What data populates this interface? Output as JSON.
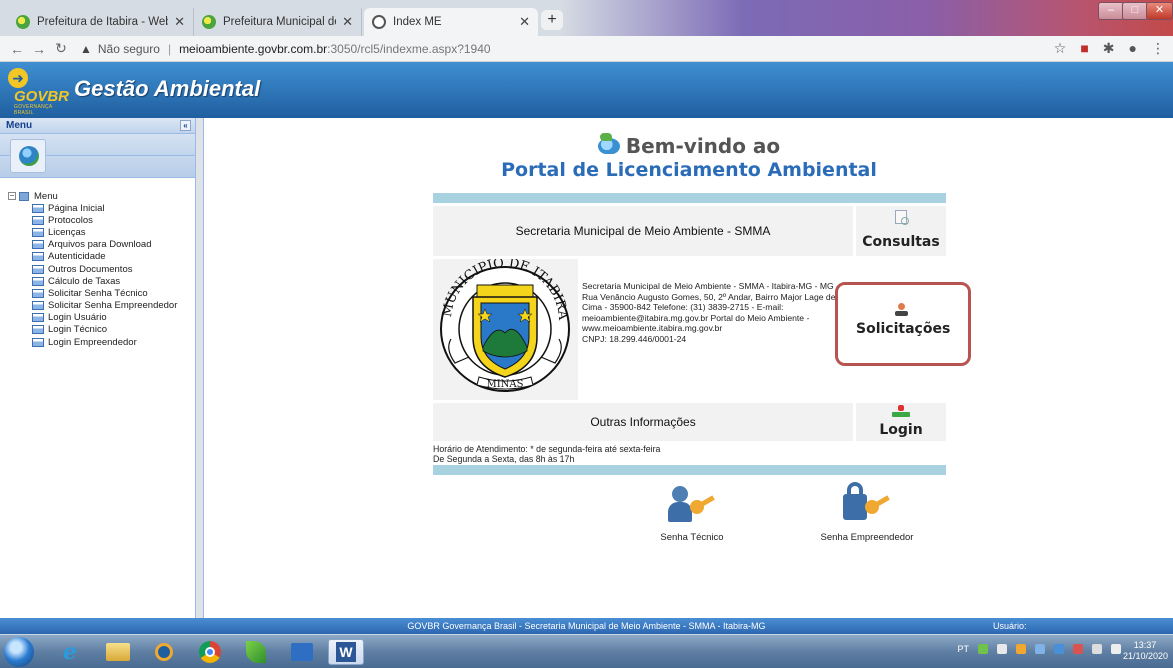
{
  "browser": {
    "tabs": [
      {
        "title": "Prefeitura de Itabira - Webmail :",
        "active": false
      },
      {
        "title": "Prefeitura Municipal de Itabira - I",
        "active": false
      },
      {
        "title": "Index ME",
        "active": true
      }
    ],
    "new_tab": "+",
    "security_label": "Não seguro",
    "url_host": "meioambiente.govbr.com.br",
    "url_path": ":3050/rcl5/indexme.aspx?1940"
  },
  "header": {
    "logo_text": "GOVBR",
    "logo_sub": "GOVERNANÇA BRASIL",
    "title": "Gestão Ambiental"
  },
  "sidebar": {
    "panel_title": "Menu",
    "root": "Menu",
    "items": [
      {
        "label": "Página Inicial"
      },
      {
        "label": "Protocolos"
      },
      {
        "label": "Licenças"
      },
      {
        "label": "Arquivos para Download"
      },
      {
        "label": "Autenticidade"
      },
      {
        "label": "Outros Documentos"
      },
      {
        "label": "Cálculo de Taxas"
      },
      {
        "label": "Solicitar Senha Técnico"
      },
      {
        "label": "Solicitar Senha Empreendedor"
      },
      {
        "label": "Login Usuário"
      },
      {
        "label": "Login Técnico"
      },
      {
        "label": "Login Empreendedor"
      }
    ]
  },
  "main": {
    "welcome_line1": "Bem-vindo ao",
    "welcome_line2": "Portal de Licenciamento Ambiental",
    "secretaria_title": "Secretaria Municipal de Meio Ambiente - SMMA",
    "consultas": "Consultas",
    "solicitacoes": "Solicitações",
    "login": "Login",
    "outras_info": "Outras Informações",
    "seal_top": "MUNICIPIO DE ITABIRA",
    "seal_bottom": "MINAS",
    "info_lines": [
      "Secretaria Municipal de Meio Ambiente - SMMA - Itabira-MG - MG",
      "Rua Venâncio Augusto Gomes, 50, 2º Andar, Bairro Major Lage de",
      "Cima - 35900-842 Telefone: (31) 3839-2715 - E-mail:",
      "meioambiente@itabira.mg.gov.br Portal do Meio Ambiente -",
      "www.meioambiente.itabira.mg.gov.br",
      "CNPJ: 18.299.446/0001-24"
    ],
    "horario_line1": "Horário de Atendimento: * de segunda-feira até sexta-feira",
    "horario_line2": "De Segunda a Sexta, das 8h às 17h",
    "senha_tecnico": "Senha Técnico",
    "senha_empreendedor": "Senha Empreendedor"
  },
  "status_bar": {
    "text": "GOVBR Governança Brasil - Secretaria Municipal de Meio Ambiente - SMMA - Itabira-MG",
    "user_label": "Usuário:"
  },
  "taskbar": {
    "word_letter": "W",
    "lang": "PT",
    "time": "13:37",
    "date": "21/10/2020"
  },
  "colors": {
    "header_blue": "#2c6fb5",
    "title_blue": "#2b6cb8",
    "band": "#a9d2e0",
    "highlight": "#b85450"
  }
}
